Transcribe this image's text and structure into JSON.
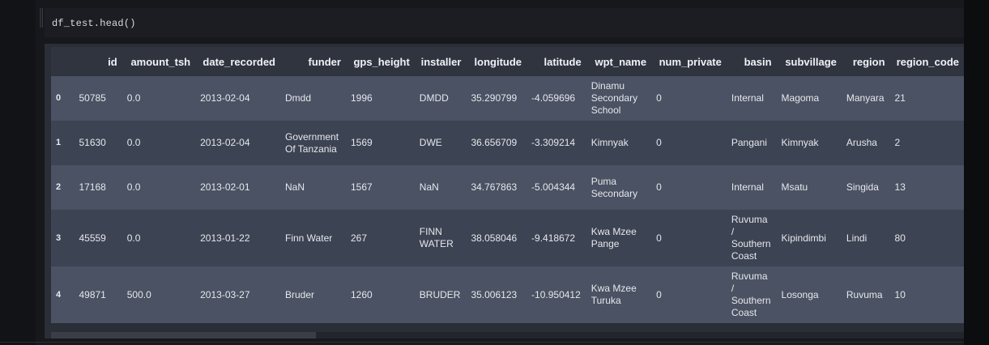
{
  "code": {
    "input": "df_test.head()"
  },
  "table": {
    "columns": [
      "",
      "id",
      "amount_tsh",
      "date_recorded",
      "funder",
      "gps_height",
      "installer",
      "longitude",
      "latitude",
      "wpt_name",
      "num_private",
      "basin",
      "subvillage",
      "region",
      "region_code"
    ],
    "rows": [
      [
        "0",
        "50785",
        "0.0",
        "2013-02-04",
        "Dmdd",
        "1996",
        "DMDD",
        "35.290799",
        "-4.059696",
        "Dinamu Secondary School",
        "0",
        "Internal",
        "Magoma",
        "Manyara",
        "21"
      ],
      [
        "1",
        "51630",
        "0.0",
        "2013-02-04",
        "Government Of Tanzania",
        "1569",
        "DWE",
        "36.656709",
        "-3.309214",
        "Kimnyak",
        "0",
        "Pangani",
        "Kimnyak",
        "Arusha",
        "2"
      ],
      [
        "2",
        "17168",
        "0.0",
        "2013-02-01",
        "NaN",
        "1567",
        "NaN",
        "34.767863",
        "-5.004344",
        "Puma Secondary",
        "0",
        "Internal",
        "Msatu",
        "Singida",
        "13"
      ],
      [
        "3",
        "45559",
        "0.0",
        "2013-01-22",
        "Finn Water",
        "267",
        "FINN WATER",
        "38.058046",
        "-9.418672",
        "Kwa Mzee Pange",
        "0",
        "Ruvuma / Southern Coast",
        "Kipindimbi",
        "Lindi",
        "80"
      ],
      [
        "4",
        "49871",
        "500.0",
        "2013-03-27",
        "Bruder",
        "1260",
        "BRUDER",
        "35.006123",
        "-10.950412",
        "Kwa Mzee Turuka",
        "0",
        "Ruvuma / Southern Coast",
        "Losonga",
        "Ruvuma",
        "10"
      ]
    ]
  }
}
